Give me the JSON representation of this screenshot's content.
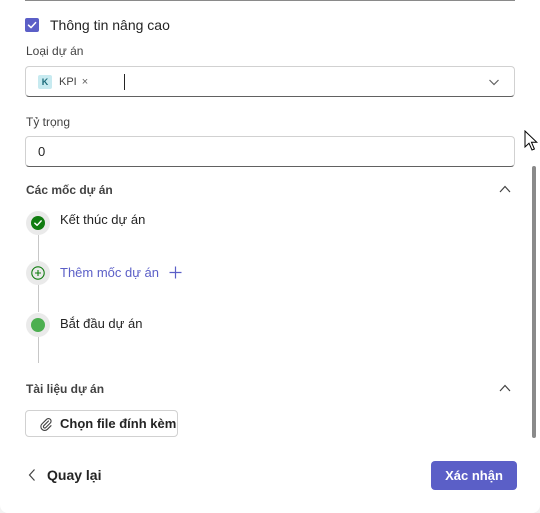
{
  "advanced": {
    "label": "Thông tin nâng cao",
    "checked": true
  },
  "project_type": {
    "label": "Loại dự án",
    "tag": {
      "avatar_letter": "K",
      "label": "KPI",
      "remove_icon": "×"
    }
  },
  "weight": {
    "label": "Tỷ trọng",
    "value": "0"
  },
  "milestones": {
    "title": "Các mốc dự án",
    "items": [
      {
        "label": "Kết thúc dự án",
        "icon": "check-circle-icon",
        "color": "#107c10"
      },
      {
        "label": "Thêm mốc dự án",
        "icon": "add-circle-icon",
        "color": "#5b5fc7"
      },
      {
        "label": "Bắt đầu dự án",
        "icon": "filled-circle-icon",
        "color": "#4caf50"
      }
    ]
  },
  "attachments": {
    "title": "Tài liệu dự án",
    "button_label": "Chọn file đính kèm"
  },
  "footer": {
    "back_label": "Quay lại",
    "confirm_label": "Xác nhận"
  },
  "colors": {
    "accent": "#5b5fc7",
    "success": "#107c10"
  }
}
